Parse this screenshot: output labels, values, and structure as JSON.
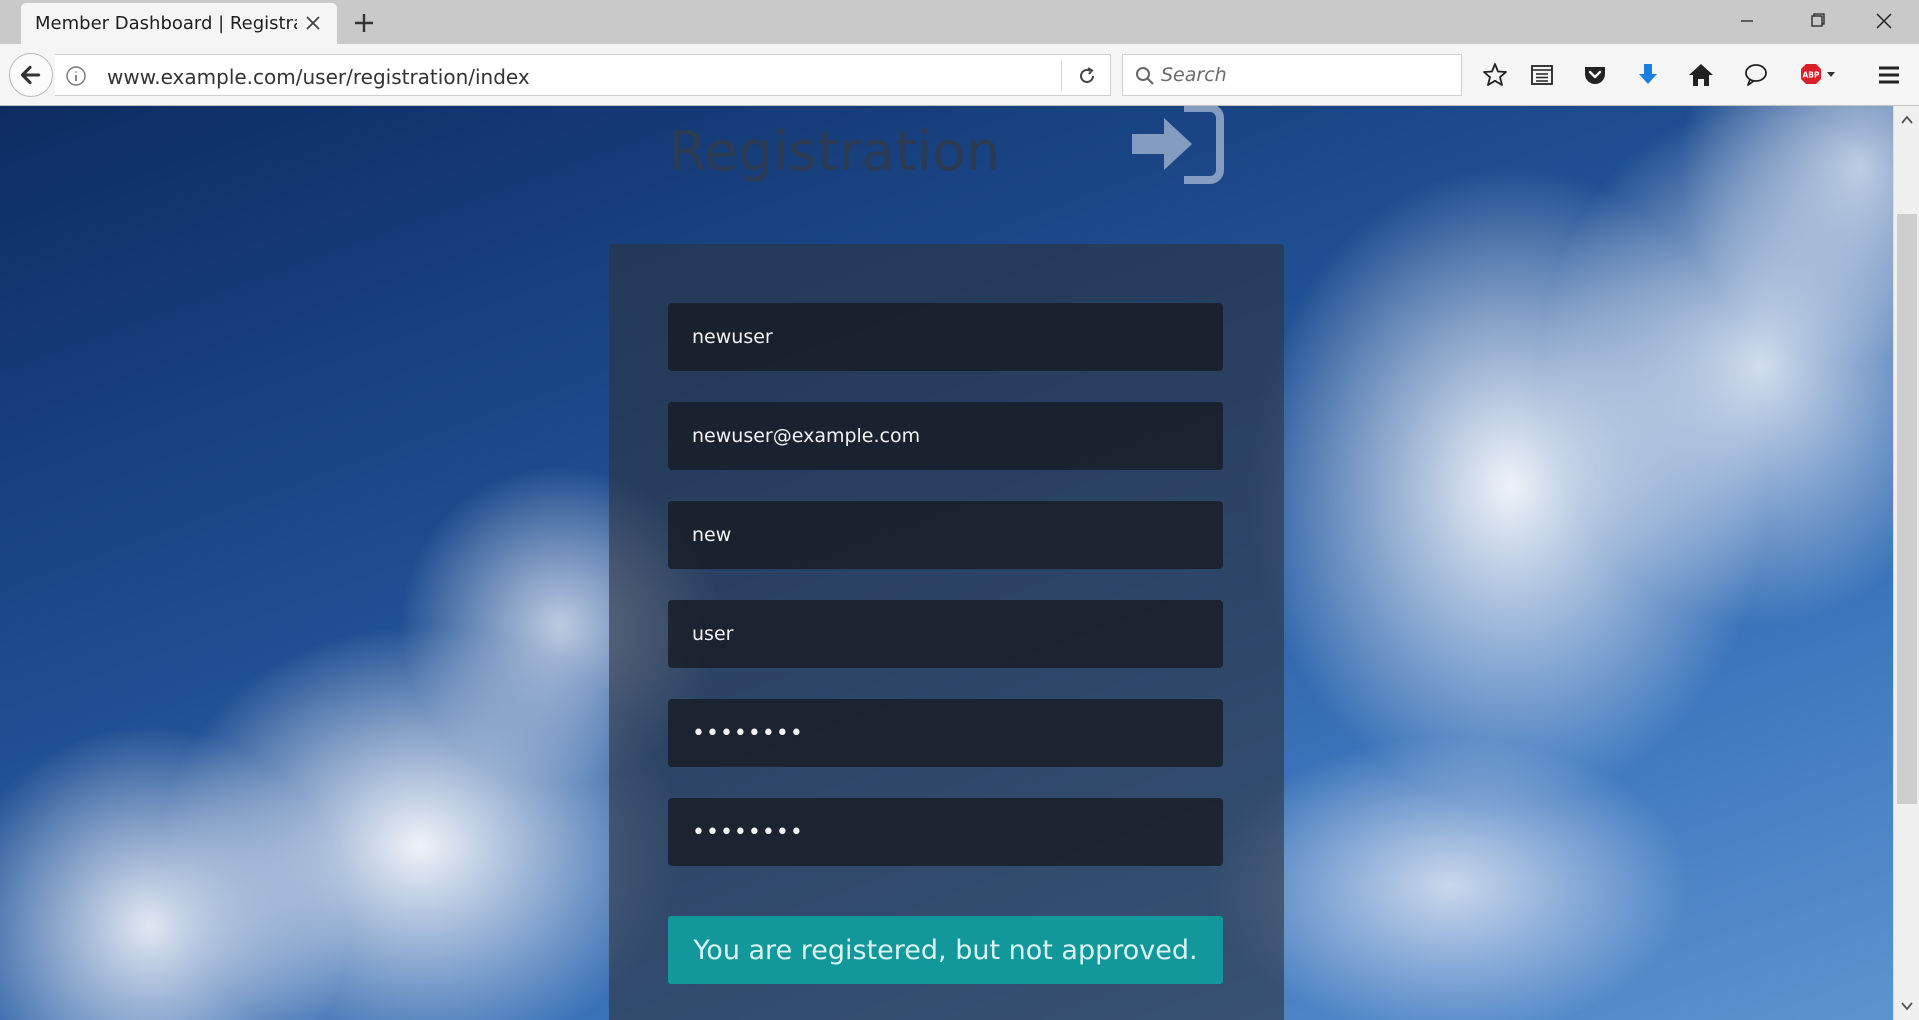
{
  "browser": {
    "tab_title": "Member Dashboard | Registra...",
    "url": "www.example.com/user/registration/index",
    "search_placeholder": "Search"
  },
  "page": {
    "title": "Registration",
    "fields": {
      "username": "newuser",
      "email": "newuser@example.com",
      "first_name": "new",
      "last_name": "user",
      "password": "••••••••",
      "confirm_password": "••••••••"
    },
    "status_message": "You are registered, but not approved."
  },
  "colors": {
    "status_bar": "#12979a",
    "download_arrow": "#1a7fe0",
    "abp_red": "#d8202b"
  },
  "icons": [
    "close-icon",
    "plus-icon",
    "minimize-icon",
    "restore-icon",
    "window-close-icon",
    "back-arrow-icon",
    "info-icon",
    "reload-icon",
    "search-icon",
    "star-icon",
    "reader-list-icon",
    "pocket-icon",
    "download-arrow-icon",
    "home-icon",
    "chat-bubble-icon",
    "adblock-icon",
    "hamburger-menu-icon",
    "sign-in-icon"
  ]
}
